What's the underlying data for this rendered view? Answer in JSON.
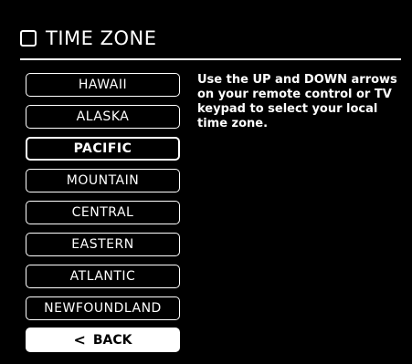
{
  "header": {
    "title": "TIME ZONE",
    "icon": "square-outline-icon"
  },
  "zones": [
    {
      "label": "HAWAII",
      "selected": false
    },
    {
      "label": "ALASKA",
      "selected": false
    },
    {
      "label": "PACIFIC",
      "selected": true
    },
    {
      "label": "MOUNTAIN",
      "selected": false
    },
    {
      "label": "CENTRAL",
      "selected": false
    },
    {
      "label": "EASTERN",
      "selected": false
    },
    {
      "label": "ATLANTIC",
      "selected": false
    },
    {
      "label": "NEWFOUNDLAND",
      "selected": false
    }
  ],
  "back": {
    "label": "BACK",
    "icon": "chevron-left-icon"
  },
  "instructions": "Use the UP and DOWN arrows on your remote control or TV keypad to select your local time zone.",
  "colors": {
    "background": "#000000",
    "foreground": "#ffffff"
  }
}
